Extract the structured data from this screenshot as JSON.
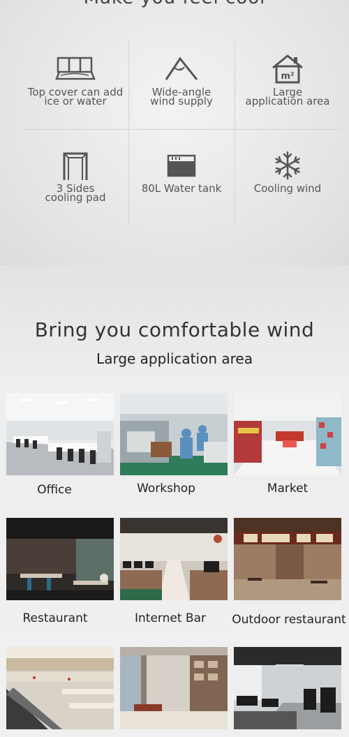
{
  "header": {
    "title": "Make you feel cool"
  },
  "features": [
    {
      "label": "Top cover can add\nice or water",
      "icon": "ice-box-icon"
    },
    {
      "label": "Wide-angle\nwind supply",
      "icon": "wide-angle-icon"
    },
    {
      "label": "Large\napplication area",
      "icon": "house-area-icon"
    },
    {
      "label": "3 Sides\ncooling pad",
      "icon": "cooling-pad-icon"
    },
    {
      "label": "80L Water tank",
      "icon": "water-tank-icon"
    },
    {
      "label": "Cooling wind",
      "icon": "snowflake-icon"
    }
  ],
  "section": {
    "title": "Bring you comfortable wind",
    "subtitle": "Large application area"
  },
  "applications": [
    {
      "label": "Office"
    },
    {
      "label": "Workshop"
    },
    {
      "label": "Market"
    },
    {
      "label": "Restaurant"
    },
    {
      "label": "Internet Bar"
    },
    {
      "label": "Outdoor restaurant"
    },
    {
      "label": ""
    },
    {
      "label": ""
    },
    {
      "label": ""
    }
  ],
  "colors": {
    "icon": "#555555",
    "text": "#333333",
    "grid_line": "#d2d2d2"
  }
}
